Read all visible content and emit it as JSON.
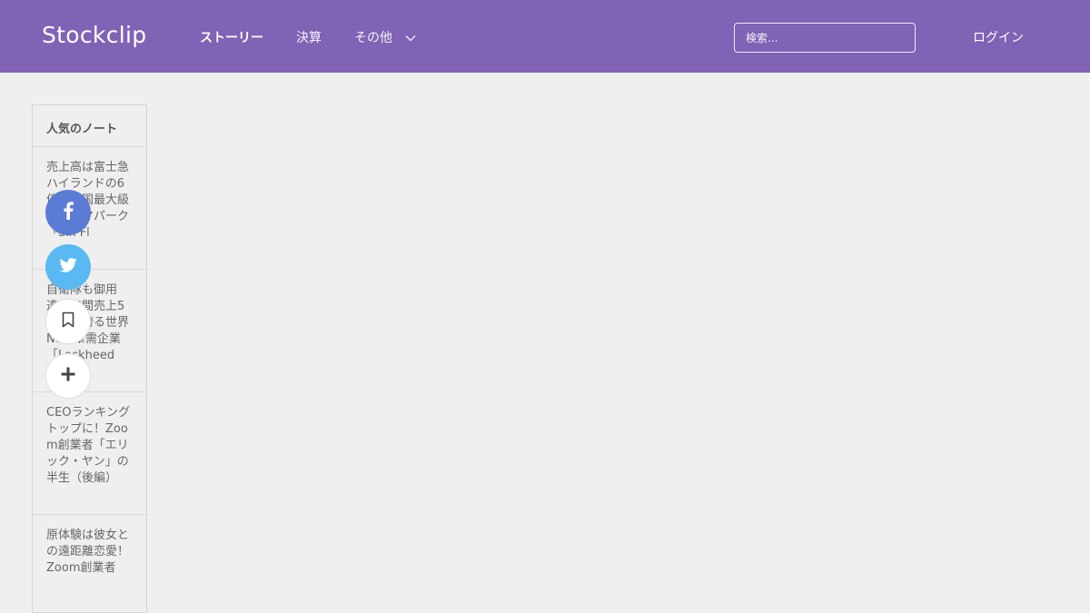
{
  "header": {
    "logo": "Stockclip",
    "nav": [
      {
        "label": "ストーリー"
      },
      {
        "label": "決算"
      },
      {
        "label": "その他"
      }
    ],
    "search_placeholder": "検索...",
    "login_label": "ログイン"
  },
  "sidebar": {
    "heading": "人気のノート",
    "items": [
      {
        "title": "売上高は富士急ハイランドの6倍！米国最大級のテーマパーク「Six Fl"
      },
      {
        "title": "自衛隊も御用達！年間売上5兆円を誇る世界No.1軍需企業「Lockheed"
      },
      {
        "title": "CEOランキングトップに！Zoom創業者「エリック・ヤン」の半生（後編）"
      },
      {
        "title": "原体験は彼女との遠距離恋愛！Zoom創業者"
      }
    ]
  },
  "share": {
    "facebook_icon": "facebook-icon",
    "twitter_icon": "twitter-icon",
    "bookmark_icon": "bookmark-icon",
    "plus_icon": "plus-icon"
  },
  "colors": {
    "header_bg": "#8063b5",
    "page_bg": "#efefef",
    "facebook": "#5b7bd5",
    "twitter": "#5ab9f2"
  }
}
